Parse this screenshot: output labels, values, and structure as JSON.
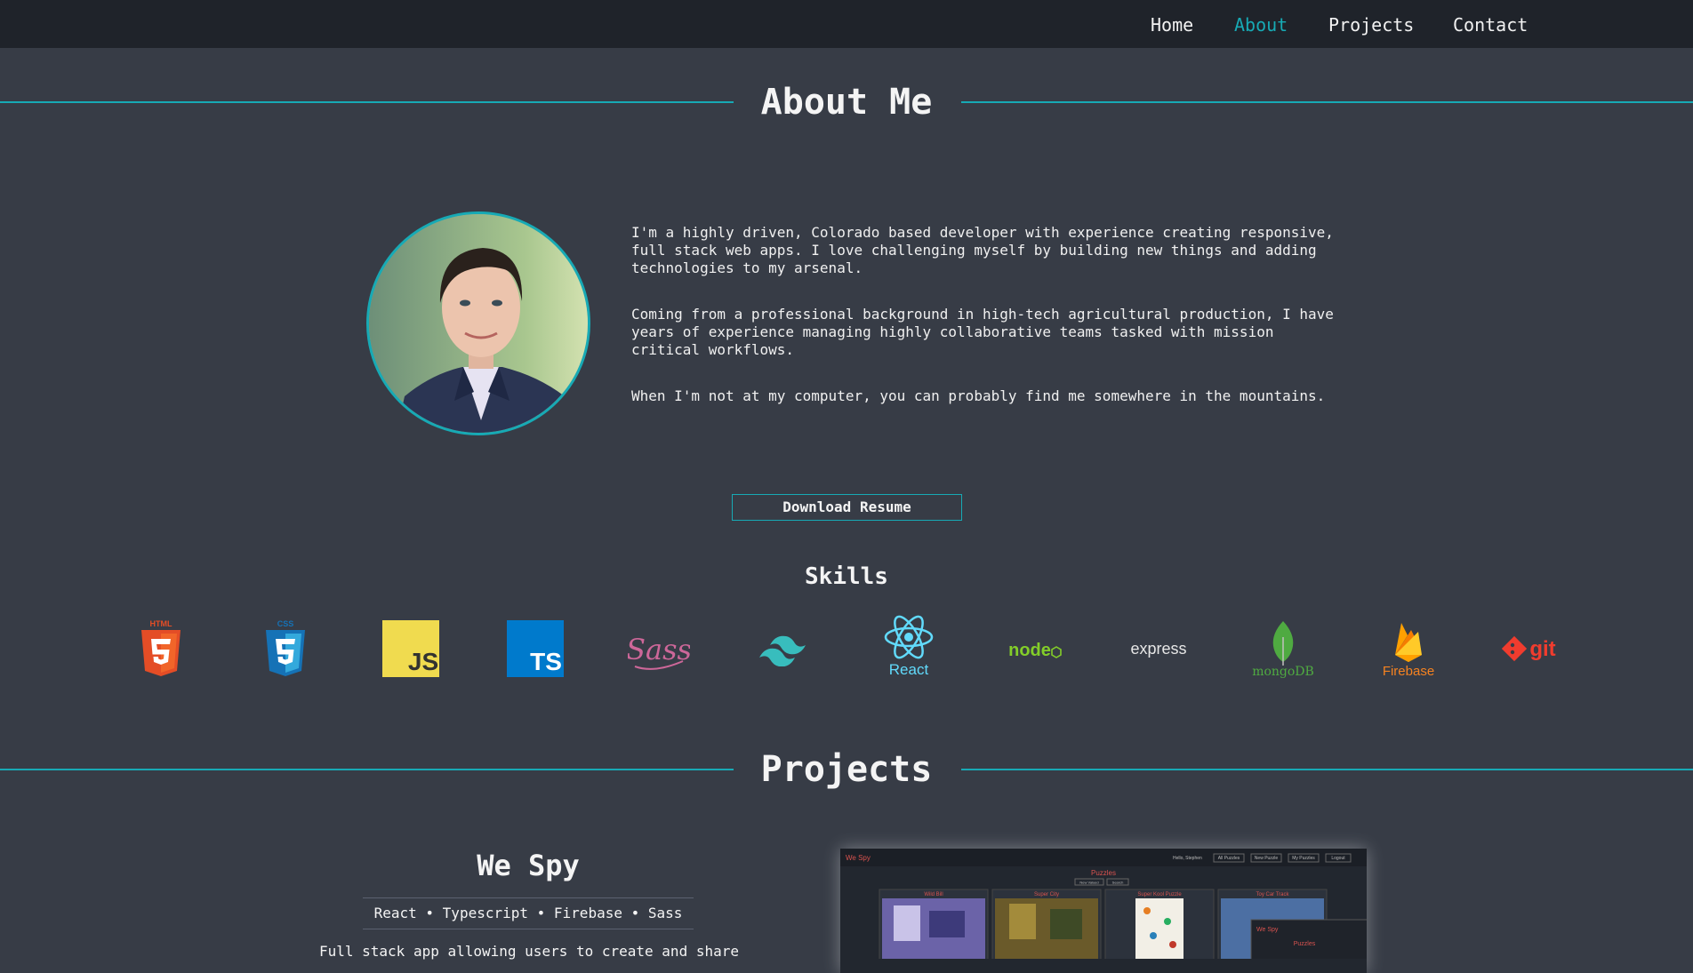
{
  "nav": {
    "home": "Home",
    "about": "About",
    "projects": "Projects",
    "contact": "Contact",
    "active": "About"
  },
  "about": {
    "title": "About Me",
    "bio": [
      "I'm a highly driven, Colorado based developer with experience creating responsive, full stack web apps. I love challenging myself by building new things and adding technologies to my arsenal.",
      "Coming from a professional background in high-tech agricultural production, I have years of experience managing highly collaborative teams tasked with mission critical workflows.",
      "When I'm not at my computer, you can probably find me somewhere in the mountains."
    ],
    "resume_button": "Download Resume"
  },
  "skills": {
    "title": "Skills",
    "items": [
      {
        "label": "HTML",
        "icon": "html5-icon",
        "color": "#e44d26"
      },
      {
        "label": "CSS",
        "icon": "css3-icon",
        "color": "#1572b6"
      },
      {
        "label": "JS",
        "icon": "javascript-icon",
        "color": "#f0db4f"
      },
      {
        "label": "TS",
        "icon": "typescript-icon",
        "color": "#007acc"
      },
      {
        "label": "Sass",
        "icon": "sass-icon",
        "color": "#cd6799"
      },
      {
        "label": "",
        "icon": "tailwind-icon",
        "color": "#38bdbd"
      },
      {
        "label": "React",
        "icon": "react-icon",
        "color": "#61dafb"
      },
      {
        "label": "node",
        "icon": "node-icon",
        "color": "#83cd29"
      },
      {
        "label": "express",
        "icon": "express-icon",
        "color": "#e6e6e6"
      },
      {
        "label": "mongoDB",
        "icon": "mongodb-icon",
        "color": "#4faa41"
      },
      {
        "label": "Firebase",
        "icon": "firebase-icon",
        "color": "#f58220"
      },
      {
        "label": "git",
        "icon": "git-icon",
        "color": "#f03c2e"
      }
    ]
  },
  "projects": {
    "title": "Projects",
    "items": [
      {
        "name": "We Spy",
        "tech": [
          "React",
          "Typescript",
          "Firebase",
          "Sass"
        ],
        "description": "Full stack app allowing users to create and share",
        "preview": {
          "brand": "We Spy",
          "heading": "Puzzles",
          "user": "Hello, Stephen",
          "nav": [
            "All Puzzles",
            "New Puzzle",
            "My Puzzles",
            "Logout"
          ],
          "buttons": [
            "New Valued",
            "Search"
          ],
          "cards": [
            "Wild Bill",
            "Super City",
            "Super Kool Puzzle",
            "Toy Car Track"
          ]
        }
      }
    ]
  },
  "colors": {
    "accent": "#17aab5",
    "background": "#373c46",
    "navbar": "#1f232a"
  }
}
